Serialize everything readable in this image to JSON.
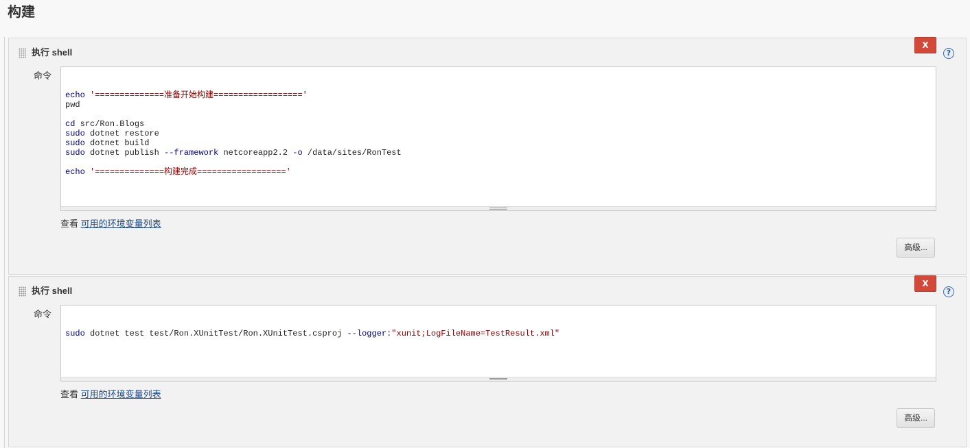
{
  "page": {
    "title": "构建"
  },
  "steps": [
    {
      "title": "执行 shell",
      "delete_label": "X",
      "help_label": "?",
      "field_label": "命令",
      "code": [
        [
          {
            "t": "echo",
            "c": "kw"
          },
          {
            "t": " '",
            "c": "str"
          },
          {
            "t": "==============准备开始构建==================",
            "c": "str"
          },
          {
            "t": "'",
            "c": "str"
          }
        ],
        [
          {
            "t": "pwd",
            "c": "plain"
          }
        ],
        [
          {
            "t": "",
            "c": "plain"
          }
        ],
        [
          {
            "t": "cd",
            "c": "kw"
          },
          {
            "t": " src/Ron.Blogs",
            "c": "plain"
          }
        ],
        [
          {
            "t": "sudo",
            "c": "kw"
          },
          {
            "t": " dotnet restore",
            "c": "plain"
          }
        ],
        [
          {
            "t": "sudo",
            "c": "kw"
          },
          {
            "t": " dotnet build",
            "c": "plain"
          }
        ],
        [
          {
            "t": "sudo",
            "c": "kw"
          },
          {
            "t": " dotnet publish ",
            "c": "plain"
          },
          {
            "t": "--framework",
            "c": "kw"
          },
          {
            "t": " netcoreapp2.2 ",
            "c": "plain"
          },
          {
            "t": "-o",
            "c": "kw"
          },
          {
            "t": " /data/sites/RonTest",
            "c": "plain"
          }
        ],
        [
          {
            "t": "",
            "c": "plain"
          }
        ],
        [
          {
            "t": "echo",
            "c": "kw"
          },
          {
            "t": " '",
            "c": "str"
          },
          {
            "t": "==============构建完成==================",
            "c": "str"
          },
          {
            "t": "'",
            "c": "str"
          }
        ]
      ],
      "env_prefix": "查看",
      "env_link": "可用的环境变量列表",
      "advanced_label": "高级..."
    },
    {
      "title": "执行 shell",
      "delete_label": "X",
      "help_label": "?",
      "field_label": "命令",
      "code": [
        [
          {
            "t": "sudo",
            "c": "kw"
          },
          {
            "t": " dotnet test test/Ron.XUnitTest/Ron.XUnitTest.csproj ",
            "c": "plain"
          },
          {
            "t": "--logger",
            "c": "kw"
          },
          {
            "t": ":",
            "c": "plain"
          },
          {
            "t": "\"xunit;LogFileName=TestResult.xml\"",
            "c": "str"
          }
        ]
      ],
      "env_prefix": "查看",
      "env_link": "可用的环境变量列表",
      "advanced_label": "高级..."
    }
  ]
}
